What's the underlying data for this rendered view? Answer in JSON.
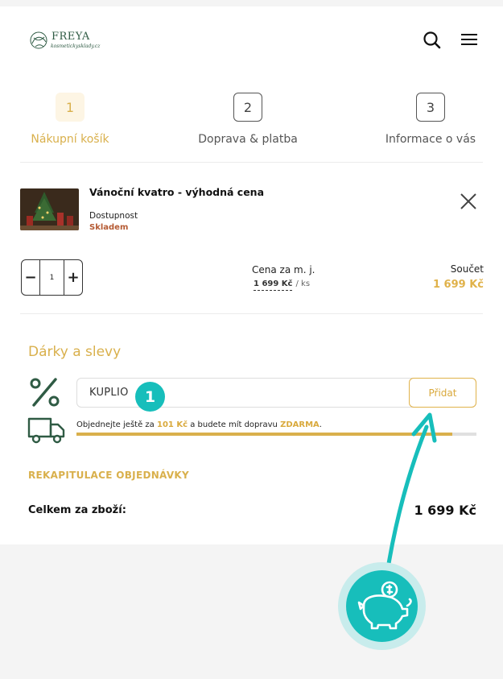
{
  "header": {
    "logo_name": "FREYA",
    "logo_tagline": "kosmetickysklady.cz",
    "search_icon": "search-icon",
    "menu_icon": "hamburger-menu-icon"
  },
  "steps": [
    {
      "number": "1",
      "label": "Nákupní košík",
      "active": true
    },
    {
      "number": "2",
      "label": "Doprava & platba",
      "active": false
    },
    {
      "number": "3",
      "label": "Informace o vás",
      "active": false
    }
  ],
  "cart_item": {
    "name": "Vánoční kvatro - výhodná cena",
    "availability_label": "Dostupnost",
    "availability_value": "Skladem",
    "quantity": "1",
    "minus_label": "−",
    "plus_label": "+",
    "unit_price_header": "Cena za m. j.",
    "unit_price": "1 699 Kč",
    "unit_suffix": "/ ks",
    "total_header": "Součet",
    "total": "1 699 Kč"
  },
  "gifts": {
    "title": "Dárky a slevy",
    "coupon_value": "KUPLIO",
    "add_button": "Přidat",
    "badge_number": "1",
    "shipping_prefix": "Objednejte ještě za",
    "shipping_amount": "101 Kč",
    "shipping_middle": "a budete mít dopravu",
    "shipping_free": "ZDARMA",
    "shipping_end": ".",
    "progress_fraction": 0.94
  },
  "recap": {
    "title": "REKAPITULACE OBJEDNÁVKY",
    "total_label": "Celkem za zboží:",
    "total_value": "1 699 Kč"
  },
  "colors": {
    "accent_gold": "#d9b04c",
    "teal": "#17bebb",
    "stock_brown": "#b55a33"
  }
}
